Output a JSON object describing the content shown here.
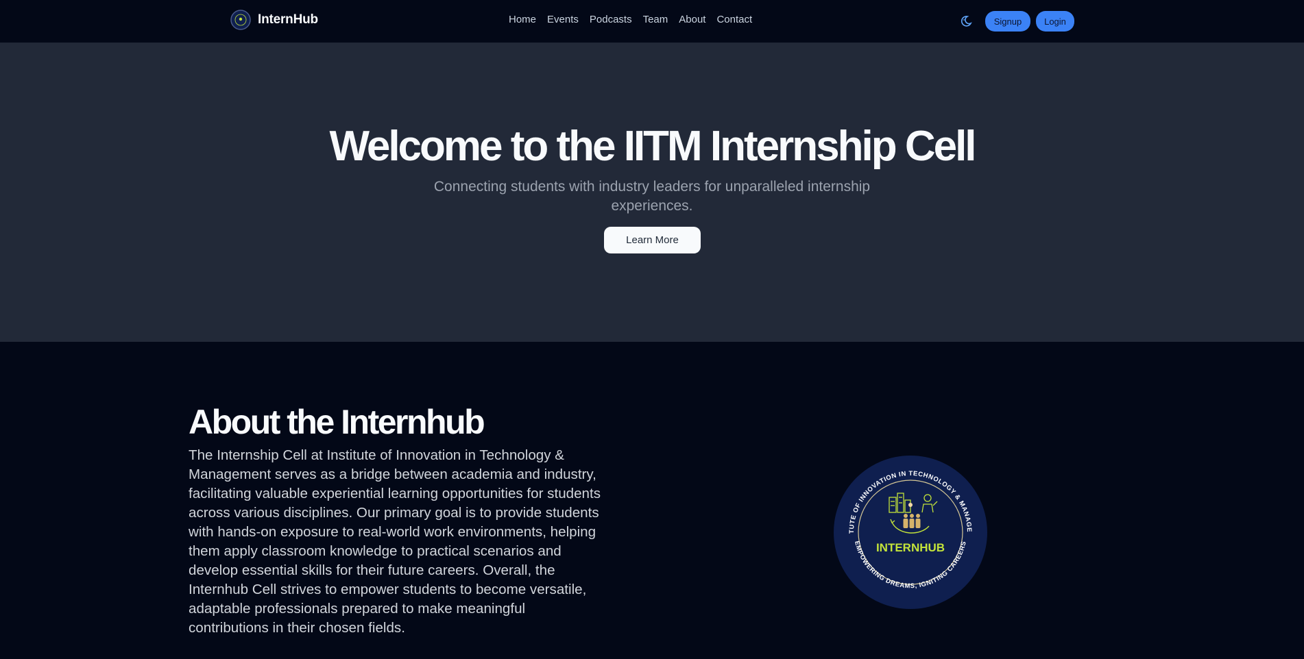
{
  "header": {
    "brand": "InternHub",
    "nav": [
      "Home",
      "Events",
      "Podcasts",
      "Team",
      "About",
      "Contact"
    ],
    "signup_label": "Signup",
    "login_label": "Login",
    "theme_icon": "moon-icon"
  },
  "hero": {
    "title": "Welcome to the IITM Internship Cell",
    "subtitle": "Connecting students with industry leaders for unparalleled internship experiences.",
    "cta_label": "Learn More"
  },
  "about": {
    "title": "About the Internhub",
    "body": "The Internship Cell at Institute of Innovation in Technology & Management serves as a bridge between academia and industry, facilitating valuable experiential learning opportunities for students across various disciplines. Our primary goal is to provide students with hands-on exposure to real-world work environments, helping them apply classroom knowledge to practical scenarios and develop essential skills for their future careers. Overall, the Internhub Cell strives to empower students to become versatile, adaptable professionals prepared to make meaningful contributions in their chosen fields.",
    "seal": {
      "top_text": "INSTITUTE OF INNOVATION IN TECHNOLOGY & MANAGEMENT",
      "bottom_text": "• EMPOWERING DREAMS, IGNITING CAREERS •",
      "center_text": "INTERNHUB"
    }
  },
  "colors": {
    "accent": "#3b82f6",
    "hero_bg": "#222938",
    "page_bg": "#030817",
    "seal_bg": "#0f1f4f",
    "seal_text": "#c3e33a"
  }
}
